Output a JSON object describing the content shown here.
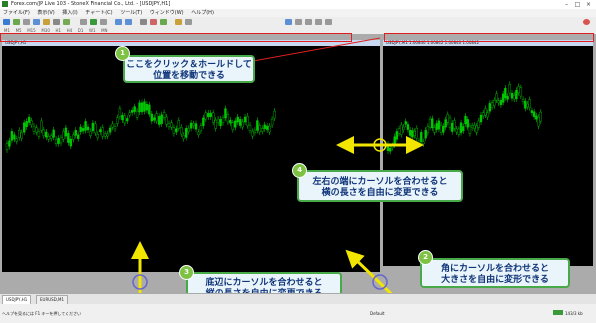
{
  "window": {
    "title": "Forex.com/JP Live 103 - StoneX Financial Co., Ltd. - [USDJPY,H1]"
  },
  "menu": [
    "ファイル(F)",
    "表示(V)",
    "挿入(I)",
    "チャート(C)",
    "ツール(T)",
    "ウィンドウ(W)",
    "ヘルプ(H)"
  ],
  "toolbar": {
    "new_order": "新規注文",
    "auto_trade": "自動売買",
    "timeframes": [
      "M1",
      "M5",
      "M15",
      "M30",
      "H1",
      "H4",
      "D1",
      "W1",
      "MN"
    ]
  },
  "charts": {
    "left_title": "USDJPY,H1",
    "right_title": "USDJPY,M1 1.00840 1.00842 1.00840 1.00842"
  },
  "callouts": {
    "c1": {
      "num": "1",
      "line1": "ここをクリック＆ホールドして",
      "line2": "位置を移動できる"
    },
    "c2": {
      "num": "2",
      "line1": "角にカーソルを合わせると",
      "line2": "大きさを自由に変形できる"
    },
    "c3": {
      "num": "3",
      "line1": "底辺にカーソルを合わせると",
      "line2": "縦の長さを自由に変更できる"
    },
    "c4": {
      "num": "4",
      "line1": "左右の端にカーソルを合わせると",
      "line2": "横の長さを自由に変更できる"
    }
  },
  "tabs": [
    "USDJPY,H1",
    "EURUSD,M1"
  ],
  "status": {
    "help": "ヘルプを見るには F1 キーを押してください",
    "profile": "Default",
    "traffic": "143/3 kb"
  },
  "colors": {
    "candle": "#00c800",
    "callout_border": "#48a948",
    "callout_text": "#10357a",
    "highlight": "#e02020",
    "arrow": "#f2e600",
    "badge": "#7dc243"
  },
  "icons": [
    "app-icon",
    "minimize-icon",
    "maximize-icon",
    "close-icon",
    "help-icon"
  ]
}
